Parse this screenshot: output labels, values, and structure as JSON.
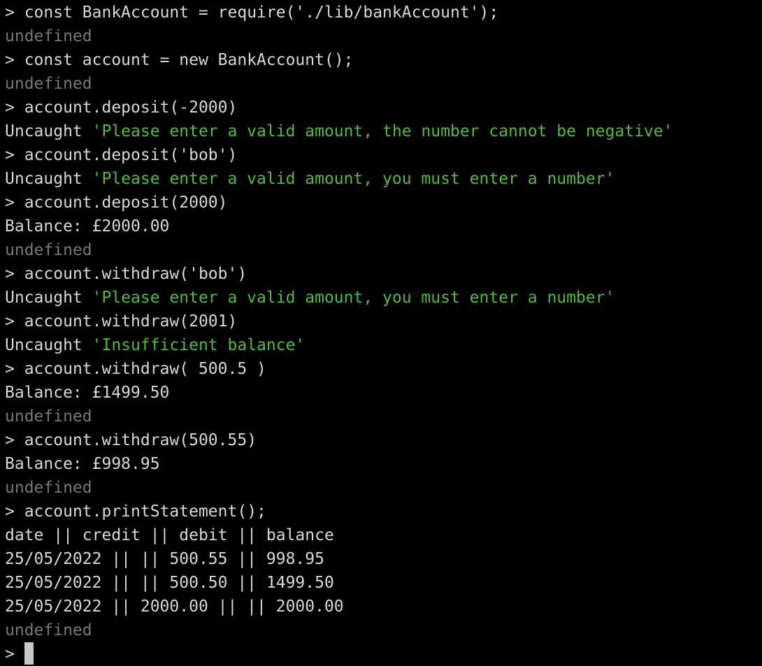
{
  "terminal": {
    "prompt": "> ",
    "lines": [
      {
        "type": "input",
        "text": "const BankAccount = require('./lib/bankAccount');"
      },
      {
        "type": "result",
        "text": "undefined"
      },
      {
        "type": "input",
        "text": "const account = new BankAccount();"
      },
      {
        "type": "result",
        "text": "undefined"
      },
      {
        "type": "input",
        "text": "account.deposit(-2000)"
      },
      {
        "type": "error",
        "prefix": "Uncaught ",
        "text": "'Please enter a valid amount, the number cannot be negative'"
      },
      {
        "type": "input",
        "text": "account.deposit('bob')"
      },
      {
        "type": "error",
        "prefix": "Uncaught ",
        "text": "'Please enter a valid amount, you must enter a number'"
      },
      {
        "type": "input",
        "text": "account.deposit(2000)"
      },
      {
        "type": "output",
        "text": "Balance: £2000.00"
      },
      {
        "type": "result",
        "text": "undefined"
      },
      {
        "type": "input",
        "text": "account.withdraw('bob')"
      },
      {
        "type": "error",
        "prefix": "Uncaught ",
        "text": "'Please enter a valid amount, you must enter a number'"
      },
      {
        "type": "input",
        "text": "account.withdraw(2001)"
      },
      {
        "type": "error",
        "prefix": "Uncaught ",
        "text": "'Insufficient balance'"
      },
      {
        "type": "input",
        "text": "account.withdraw( 500.5 )"
      },
      {
        "type": "output",
        "text": "Balance: £1499.50"
      },
      {
        "type": "result",
        "text": "undefined"
      },
      {
        "type": "input",
        "text": "account.withdraw(500.55)"
      },
      {
        "type": "output",
        "text": "Balance: £998.95"
      },
      {
        "type": "result",
        "text": "undefined"
      },
      {
        "type": "input",
        "text": "account.printStatement();"
      },
      {
        "type": "output",
        "text": "date || credit || debit || balance"
      },
      {
        "type": "output",
        "text": "25/05/2022 || || 500.55 || 998.95"
      },
      {
        "type": "output",
        "text": "25/05/2022 || || 500.50 || 1499.50"
      },
      {
        "type": "output",
        "text": "25/05/2022 || 2000.00 || || 2000.00"
      },
      {
        "type": "result",
        "text": "undefined"
      }
    ],
    "current_input": ""
  },
  "colors": {
    "background": "#000000",
    "text": "#d8d8d8",
    "result": "#777777",
    "string": "#4dbd34"
  }
}
